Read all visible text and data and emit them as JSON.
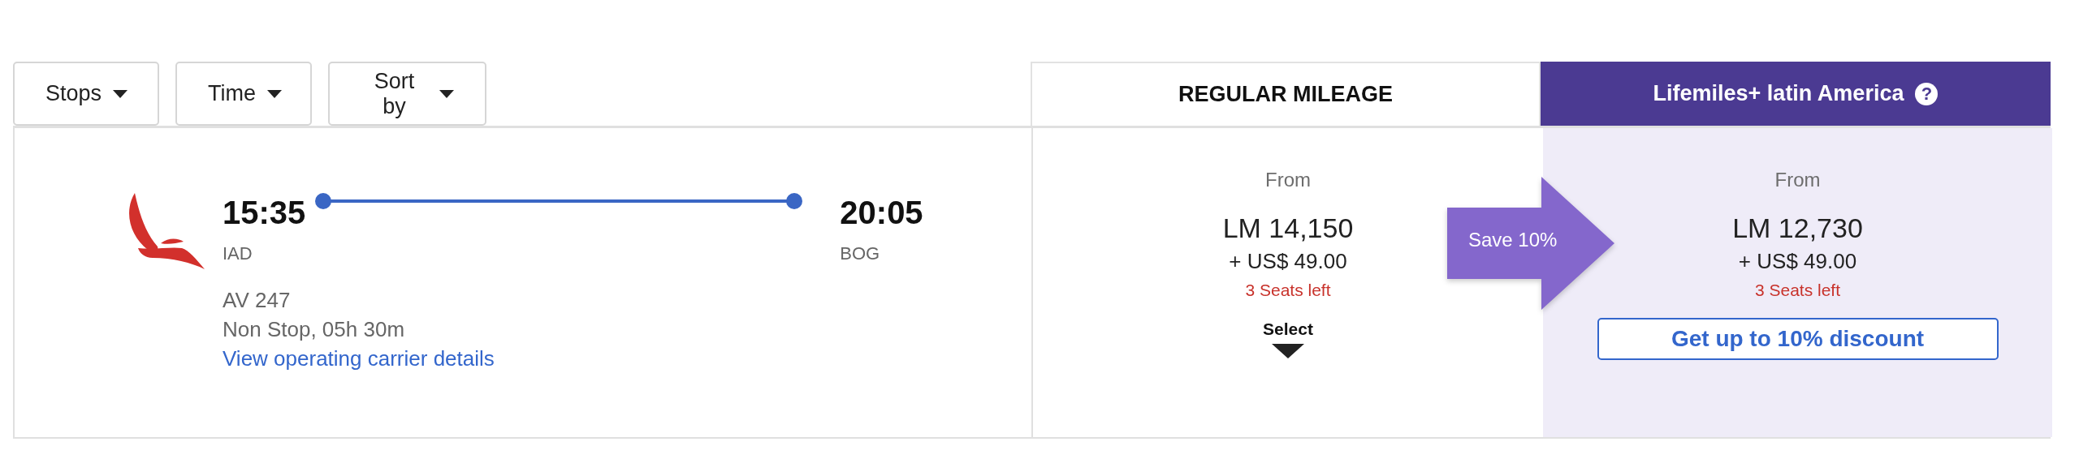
{
  "filters": [
    {
      "label": "Stops"
    },
    {
      "label": "Time"
    },
    {
      "label": "Sort by"
    }
  ],
  "fare_headers": [
    {
      "kind": "regular",
      "label": "REGULAR MILEAGE"
    },
    {
      "kind": "promo",
      "label": "Lifemiles+ latin America",
      "help_mark": "?"
    }
  ],
  "flight": {
    "departure_time": "15:35",
    "departure_airport": "IAD",
    "arrival_time": "20:05",
    "arrival_airport": "BOG",
    "flight_number": "AV 247",
    "duration": "Non Stop, 05h 30m",
    "details_link": "View operating carrier details"
  },
  "fares": [
    {
      "kind": "regular",
      "from": "From",
      "miles": "LM 14,150",
      "taxes": "+ US$ 49.00",
      "seats": "3 Seats left",
      "action": "Select"
    },
    {
      "kind": "promo",
      "from": "From",
      "miles": "LM 12,730",
      "taxes": "+ US$ 49.00",
      "seats": "3 Seats left",
      "action": "Get up to 10% discount"
    }
  ],
  "savings_badge": "Save 10%"
}
